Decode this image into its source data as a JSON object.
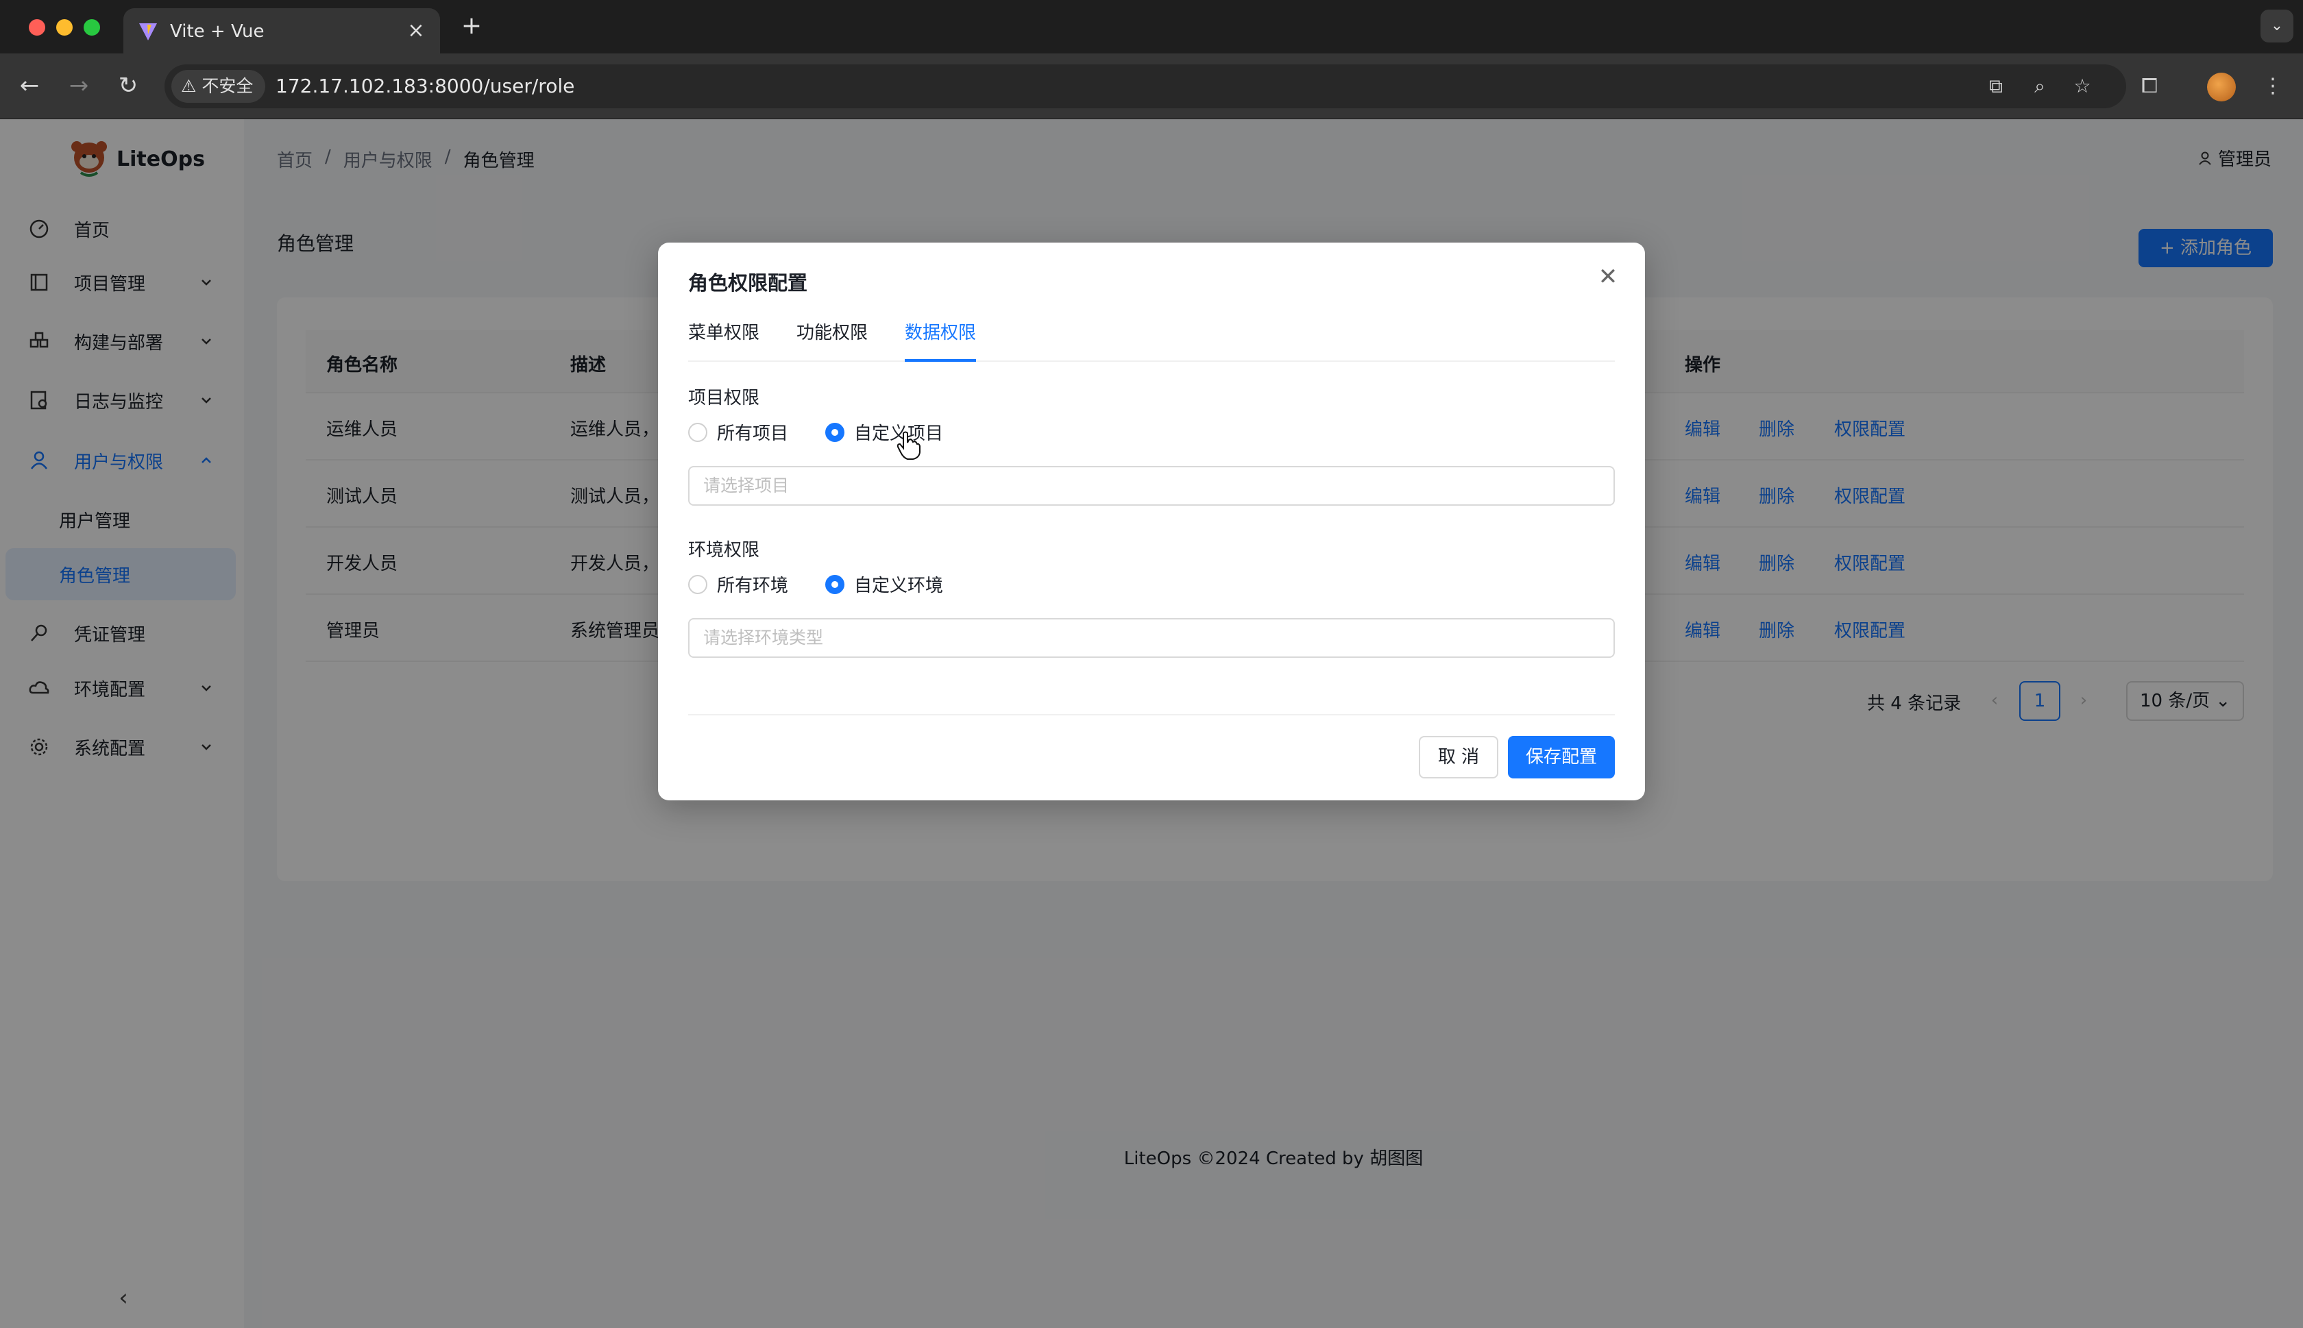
{
  "browser": {
    "tab_title": "Vite + Vue",
    "security_label": "不安全",
    "url": "172.17.102.183:8000/user/role"
  },
  "app": {
    "logo_text": "LiteOps",
    "user_label": "管理员",
    "footer": "LiteOps ©2024 Created by 胡图图"
  },
  "sidebar": {
    "items": [
      {
        "label": "首页"
      },
      {
        "label": "项目管理"
      },
      {
        "label": "构建与部署"
      },
      {
        "label": "日志与监控"
      },
      {
        "label": "用户与权限"
      },
      {
        "label": "凭证管理"
      },
      {
        "label": "环境配置"
      },
      {
        "label": "系统配置"
      }
    ],
    "sub_items": [
      {
        "label": "用户管理"
      },
      {
        "label": "角色管理"
      }
    ]
  },
  "breadcrumb": [
    "首页",
    "/",
    "用户与权限",
    "/",
    "角色管理"
  ],
  "page": {
    "title": "角色管理",
    "add_button": "添加角色"
  },
  "table": {
    "columns": [
      "角色名称",
      "描述",
      "操作"
    ],
    "rows": [
      {
        "name": "运维人员",
        "desc": "运维人员，"
      },
      {
        "name": "测试人员",
        "desc": "测试人员，"
      },
      {
        "name": "开发人员",
        "desc": "开发人员，"
      },
      {
        "name": "管理员",
        "desc": "系统管理员"
      }
    ],
    "actions": {
      "edit": "编辑",
      "delete": "删除",
      "perm": "权限配置"
    }
  },
  "pagination": {
    "total": "共 4 条记录",
    "current": "1",
    "page_size": "10 条/页"
  },
  "modal": {
    "title": "角色权限配置",
    "tabs": [
      {
        "label": "菜单权限"
      },
      {
        "label": "功能权限"
      },
      {
        "label": "数据权限"
      }
    ],
    "active_tab": "数据权限",
    "project": {
      "label": "项目权限",
      "option_all": "所有项目",
      "option_custom": "自定义项目",
      "selected": "自定义项目",
      "placeholder": "请选择项目"
    },
    "env": {
      "label": "环境权限",
      "option_all": "所有环境",
      "option_custom": "自定义环境",
      "selected": "自定义环境",
      "placeholder": "请选择环境类型"
    },
    "cancel": "取 消",
    "save": "保存配置"
  },
  "colors": {
    "primary": "#1677ff"
  }
}
